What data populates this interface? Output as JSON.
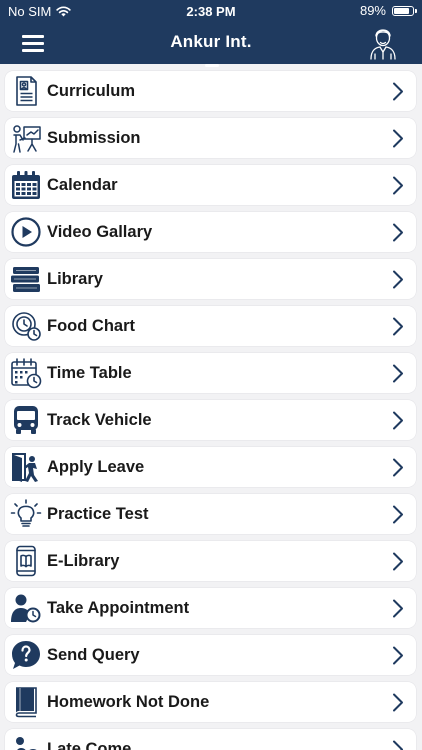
{
  "status_bar": {
    "carrier": "No SIM",
    "time": "2:38 PM",
    "battery": "89%",
    "battery_level": 0.89
  },
  "header": {
    "title": "Ankur Int."
  },
  "menu": {
    "items": [
      {
        "label": "Curriculum",
        "icon": "curriculum-icon"
      },
      {
        "label": "Submission",
        "icon": "submission-icon"
      },
      {
        "label": "Calendar",
        "icon": "calendar-icon"
      },
      {
        "label": "Video Gallary",
        "icon": "video-icon"
      },
      {
        "label": "Library",
        "icon": "library-icon"
      },
      {
        "label": "Food Chart",
        "icon": "food-chart-icon"
      },
      {
        "label": "Time Table",
        "icon": "time-table-icon"
      },
      {
        "label": "Track Vehicle",
        "icon": "bus-icon"
      },
      {
        "label": "Apply Leave",
        "icon": "leave-icon"
      },
      {
        "label": "Practice Test",
        "icon": "bulb-icon"
      },
      {
        "label": "E-Library",
        "icon": "e-library-icon"
      },
      {
        "label": "Take Appointment",
        "icon": "appointment-icon"
      },
      {
        "label": "Send Query",
        "icon": "query-icon"
      },
      {
        "label": "Homework Not Done",
        "icon": "homework-icon"
      },
      {
        "label": "Late Come",
        "icon": "late-come-icon"
      }
    ]
  },
  "colors": {
    "header_bg": "#1f3a5f",
    "icon": "#1f3a5f",
    "background": "#f2f2f4"
  }
}
